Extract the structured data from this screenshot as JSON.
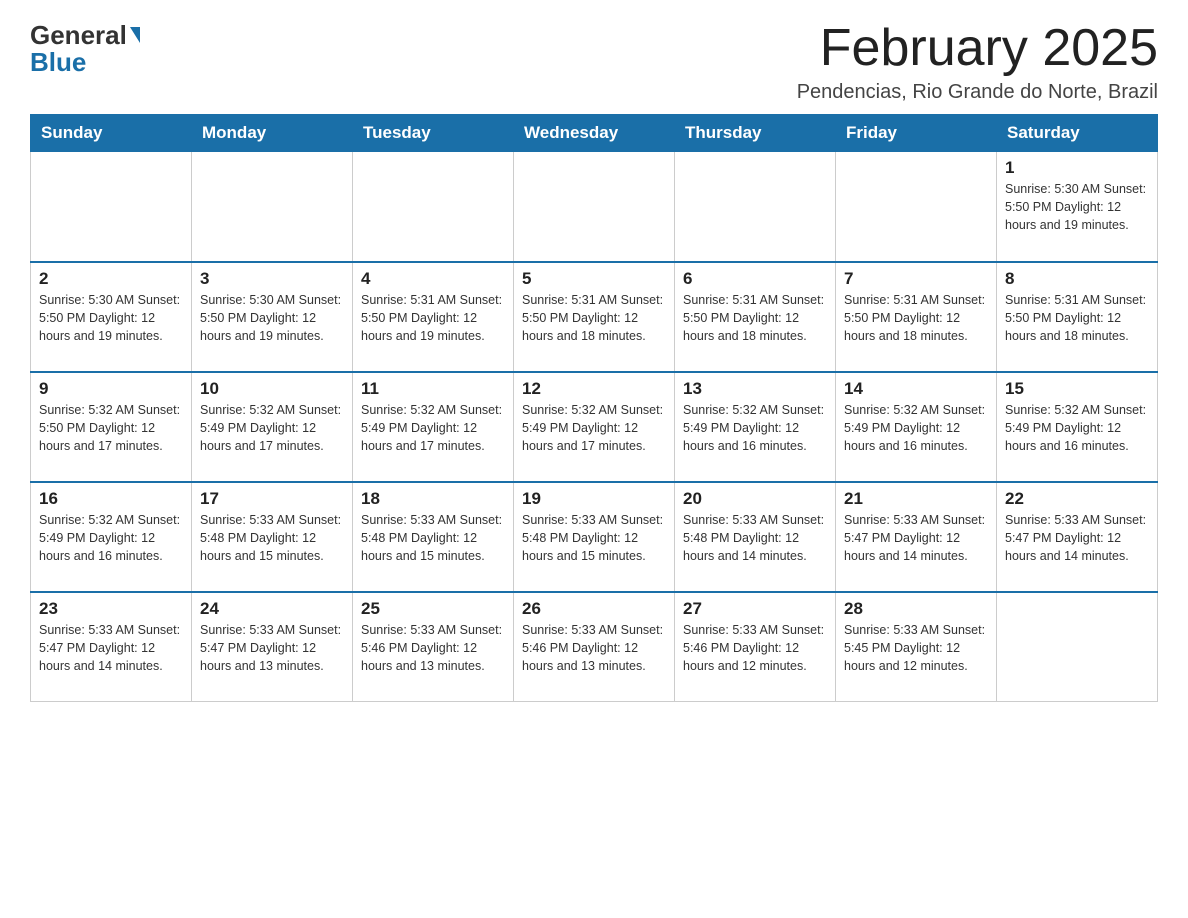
{
  "header": {
    "logo_general": "General",
    "logo_blue": "Blue",
    "month_title": "February 2025",
    "location": "Pendencias, Rio Grande do Norte, Brazil"
  },
  "weekdays": [
    "Sunday",
    "Monday",
    "Tuesday",
    "Wednesday",
    "Thursday",
    "Friday",
    "Saturday"
  ],
  "weeks": [
    [
      {
        "day": "",
        "info": ""
      },
      {
        "day": "",
        "info": ""
      },
      {
        "day": "",
        "info": ""
      },
      {
        "day": "",
        "info": ""
      },
      {
        "day": "",
        "info": ""
      },
      {
        "day": "",
        "info": ""
      },
      {
        "day": "1",
        "info": "Sunrise: 5:30 AM\nSunset: 5:50 PM\nDaylight: 12 hours\nand 19 minutes."
      }
    ],
    [
      {
        "day": "2",
        "info": "Sunrise: 5:30 AM\nSunset: 5:50 PM\nDaylight: 12 hours\nand 19 minutes."
      },
      {
        "day": "3",
        "info": "Sunrise: 5:30 AM\nSunset: 5:50 PM\nDaylight: 12 hours\nand 19 minutes."
      },
      {
        "day": "4",
        "info": "Sunrise: 5:31 AM\nSunset: 5:50 PM\nDaylight: 12 hours\nand 19 minutes."
      },
      {
        "day": "5",
        "info": "Sunrise: 5:31 AM\nSunset: 5:50 PM\nDaylight: 12 hours\nand 18 minutes."
      },
      {
        "day": "6",
        "info": "Sunrise: 5:31 AM\nSunset: 5:50 PM\nDaylight: 12 hours\nand 18 minutes."
      },
      {
        "day": "7",
        "info": "Sunrise: 5:31 AM\nSunset: 5:50 PM\nDaylight: 12 hours\nand 18 minutes."
      },
      {
        "day": "8",
        "info": "Sunrise: 5:31 AM\nSunset: 5:50 PM\nDaylight: 12 hours\nand 18 minutes."
      }
    ],
    [
      {
        "day": "9",
        "info": "Sunrise: 5:32 AM\nSunset: 5:50 PM\nDaylight: 12 hours\nand 17 minutes."
      },
      {
        "day": "10",
        "info": "Sunrise: 5:32 AM\nSunset: 5:49 PM\nDaylight: 12 hours\nand 17 minutes."
      },
      {
        "day": "11",
        "info": "Sunrise: 5:32 AM\nSunset: 5:49 PM\nDaylight: 12 hours\nand 17 minutes."
      },
      {
        "day": "12",
        "info": "Sunrise: 5:32 AM\nSunset: 5:49 PM\nDaylight: 12 hours\nand 17 minutes."
      },
      {
        "day": "13",
        "info": "Sunrise: 5:32 AM\nSunset: 5:49 PM\nDaylight: 12 hours\nand 16 minutes."
      },
      {
        "day": "14",
        "info": "Sunrise: 5:32 AM\nSunset: 5:49 PM\nDaylight: 12 hours\nand 16 minutes."
      },
      {
        "day": "15",
        "info": "Sunrise: 5:32 AM\nSunset: 5:49 PM\nDaylight: 12 hours\nand 16 minutes."
      }
    ],
    [
      {
        "day": "16",
        "info": "Sunrise: 5:32 AM\nSunset: 5:49 PM\nDaylight: 12 hours\nand 16 minutes."
      },
      {
        "day": "17",
        "info": "Sunrise: 5:33 AM\nSunset: 5:48 PM\nDaylight: 12 hours\nand 15 minutes."
      },
      {
        "day": "18",
        "info": "Sunrise: 5:33 AM\nSunset: 5:48 PM\nDaylight: 12 hours\nand 15 minutes."
      },
      {
        "day": "19",
        "info": "Sunrise: 5:33 AM\nSunset: 5:48 PM\nDaylight: 12 hours\nand 15 minutes."
      },
      {
        "day": "20",
        "info": "Sunrise: 5:33 AM\nSunset: 5:48 PM\nDaylight: 12 hours\nand 14 minutes."
      },
      {
        "day": "21",
        "info": "Sunrise: 5:33 AM\nSunset: 5:47 PM\nDaylight: 12 hours\nand 14 minutes."
      },
      {
        "day": "22",
        "info": "Sunrise: 5:33 AM\nSunset: 5:47 PM\nDaylight: 12 hours\nand 14 minutes."
      }
    ],
    [
      {
        "day": "23",
        "info": "Sunrise: 5:33 AM\nSunset: 5:47 PM\nDaylight: 12 hours\nand 14 minutes."
      },
      {
        "day": "24",
        "info": "Sunrise: 5:33 AM\nSunset: 5:47 PM\nDaylight: 12 hours\nand 13 minutes."
      },
      {
        "day": "25",
        "info": "Sunrise: 5:33 AM\nSunset: 5:46 PM\nDaylight: 12 hours\nand 13 minutes."
      },
      {
        "day": "26",
        "info": "Sunrise: 5:33 AM\nSunset: 5:46 PM\nDaylight: 12 hours\nand 13 minutes."
      },
      {
        "day": "27",
        "info": "Sunrise: 5:33 AM\nSunset: 5:46 PM\nDaylight: 12 hours\nand 12 minutes."
      },
      {
        "day": "28",
        "info": "Sunrise: 5:33 AM\nSunset: 5:45 PM\nDaylight: 12 hours\nand 12 minutes."
      },
      {
        "day": "",
        "info": ""
      }
    ]
  ]
}
